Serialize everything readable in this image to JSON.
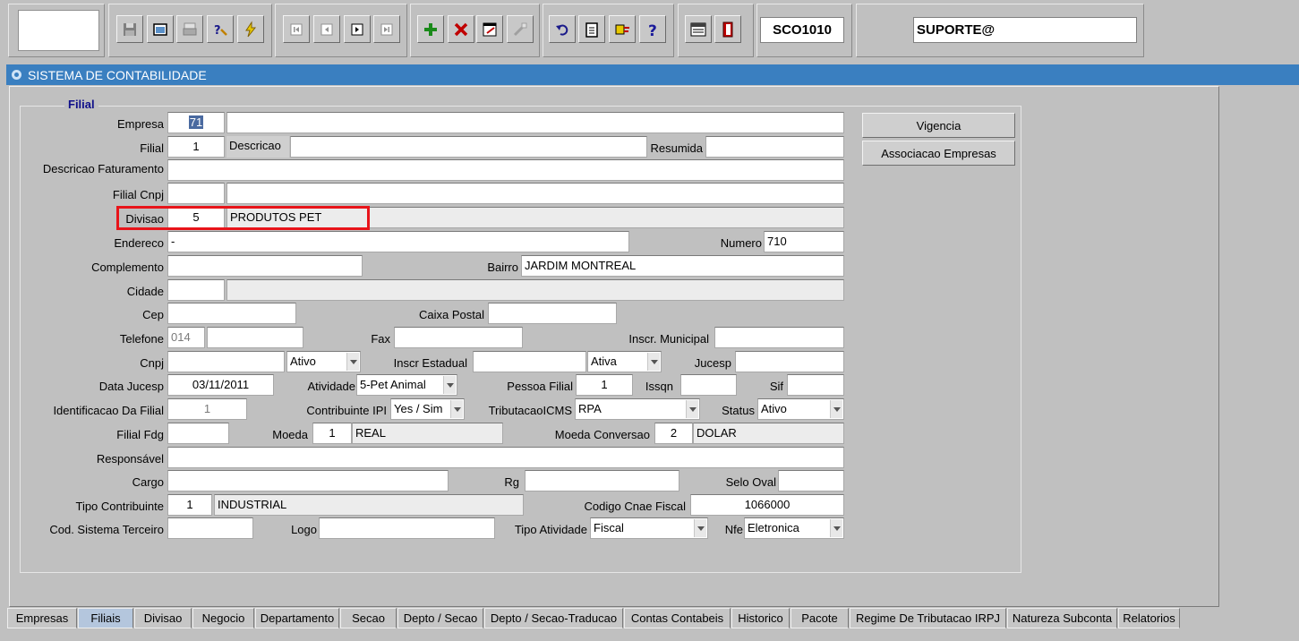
{
  "toolbar": {
    "form_code": "SCO1010",
    "user": "SUPORTE@",
    "icons": [
      "save-icon",
      "window-icon",
      "print-icon",
      "help-query-icon",
      "flash-icon",
      "first-record-icon",
      "previous-record-icon",
      "next-record-icon",
      "last-record-icon",
      "insert-record-icon",
      "delete-record-icon",
      "edit-record-icon",
      "disabled-tool-icon",
      "undo-icon",
      "clipboard-icon",
      "pointer-hand-icon",
      "help-icon",
      "menu-icon",
      "exit-icon"
    ]
  },
  "window": {
    "title": "SISTEMA DE CONTABILIDADE"
  },
  "frame": {
    "title": "Filial"
  },
  "labels": {
    "empresa": "Empresa",
    "filial": "Filial",
    "descricao": "Descricao",
    "resumida": "Resumida",
    "descricao_faturamento": "Descricao Faturamento",
    "filial_cnpj": "Filial Cnpj",
    "divisao": "Divisao",
    "endereco": "Endereco",
    "numero": "Numero",
    "complemento": "Complemento",
    "bairro": "Bairro",
    "cidade": "Cidade",
    "cep": "Cep",
    "caixa_postal": "Caixa Postal",
    "telefone": "Telefone",
    "fax": "Fax",
    "inscr_municipal": "Inscr. Municipal",
    "cnpj": "Cnpj",
    "inscr_estadual": "Inscr Estadual",
    "jucesp": "Jucesp",
    "data_jucesp": "Data Jucesp",
    "atividade": "Atividade",
    "pessoa_filial": "Pessoa Filial",
    "issqn": "Issqn",
    "sif": "Sif",
    "identificacao_filial": "Identificacao Da Filial",
    "contribuinte_ipi": "Contribuinte IPI",
    "tributacao_icms": "TributacaoICMS",
    "status": "Status",
    "filial_fdg": "Filial Fdg",
    "moeda": "Moeda",
    "moeda_conversao": "Moeda Conversao",
    "responsavel": "Responsável",
    "cargo": "Cargo",
    "rg": "Rg",
    "selo_oval": "Selo Oval",
    "tipo_contribuinte": "Tipo Contribuinte",
    "codigo_cnae_fiscal": "Codigo Cnae Fiscal",
    "cod_sistema_terceiro": "Cod. Sistema Terceiro",
    "logo": "Logo",
    "tipo_atividade": "Tipo Atividade",
    "nfe": "Nfe"
  },
  "values": {
    "empresa_code": "71",
    "empresa_name": "",
    "filial_code": "1",
    "descricao": "",
    "resumida": "",
    "descricao_faturamento": "",
    "filial_cnpj_a": "",
    "filial_cnpj_b": "",
    "divisao_code": "5",
    "divisao_name": "PRODUTOS PET",
    "endereco": "-",
    "numero": "710",
    "complemento": "",
    "bairro": "JARDIM MONTREAL",
    "cidade_code": "",
    "cidade_name": "",
    "cep": "",
    "caixa_postal": "",
    "telefone_ddd": "014",
    "telefone": "",
    "fax": "",
    "inscr_municipal": "",
    "cnpj": "",
    "cnpj_status": "Ativo",
    "inscr_estadual": "",
    "inscr_estadual_status": "Ativa",
    "jucesp": "",
    "data_jucesp": "03/11/2011",
    "atividade": "5-Pet Animal",
    "pessoa_filial": "1",
    "issqn": "",
    "sif": "",
    "identificacao_filial": "1",
    "contribuinte_ipi": "Yes / Sim",
    "tributacao_icms": "RPA",
    "status": "Ativo",
    "filial_fdg": "",
    "moeda_code": "1",
    "moeda_name": "REAL",
    "moeda_conversao_code": "2",
    "moeda_conversao_name": "DOLAR",
    "responsavel": "",
    "cargo": "",
    "rg": "",
    "selo_oval": "",
    "tipo_contribuinte_code": "1",
    "tipo_contribuinte_name": "INDUSTRIAL",
    "codigo_cnae_fiscal": "1066000",
    "cod_sistema_terceiro": "",
    "logo": "",
    "tipo_atividade": "Fiscal",
    "nfe": "Eletronica"
  },
  "buttons": {
    "vigencia": "Vigencia",
    "associacao_empresas": "Associacao Empresas"
  },
  "tabs": [
    "Empresas",
    "Filiais",
    "Divisao",
    "Negocio",
    "Departamento",
    "Secao",
    "Depto / Secao",
    "Depto / Secao-Traducao",
    "Contas Contabeis",
    "Historico",
    "Pacote",
    "Regime De Tributacao IRPJ",
    "Natureza Subconta",
    "Relatorios"
  ],
  "active_tab": "Filiais",
  "highlight_color": "#e8141a"
}
